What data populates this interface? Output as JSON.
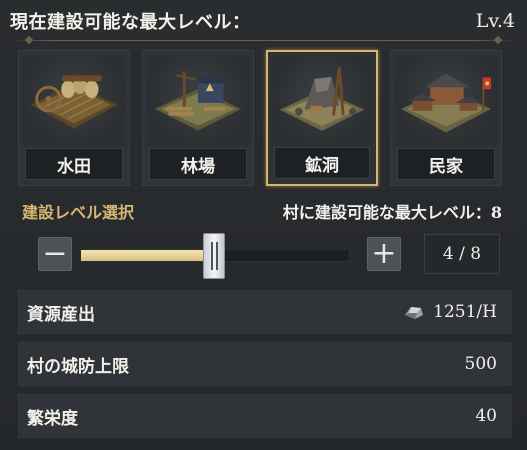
{
  "header": {
    "title": "現在建設可能な最大レベル：",
    "level": "Lv.4"
  },
  "buildings": [
    {
      "label": "水田",
      "icon": "rice-field-icon",
      "selected": false
    },
    {
      "label": "林場",
      "icon": "lumber-yard-icon",
      "selected": false
    },
    {
      "label": "鉱洞",
      "icon": "mine-icon",
      "selected": true
    },
    {
      "label": "民家",
      "icon": "house-icon",
      "selected": false
    }
  ],
  "level_select": {
    "title": "建設レベル選択",
    "village_max": "村に建設可能な最大レベル：8",
    "minus": "−",
    "plus": "+",
    "current": 4,
    "max": 8,
    "count_text": "4 / 8"
  },
  "stats": [
    {
      "label": "資源産出",
      "value": "1251/H",
      "icon": "ore-icon"
    },
    {
      "label": "村の城防上限",
      "value": "500"
    },
    {
      "label": "繁栄度",
      "value": "40"
    }
  ],
  "colors": {
    "accent_gold": "#d8b66a",
    "title_gold": "#d7b870",
    "slider_fill": "#f5e4b2"
  }
}
